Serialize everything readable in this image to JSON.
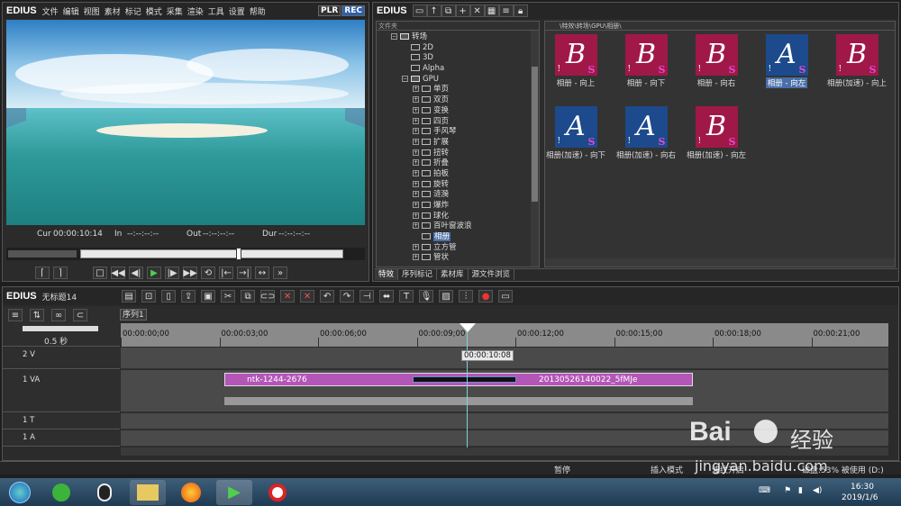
{
  "player": {
    "logo": "EDIUS",
    "menu": [
      "文件",
      "编辑",
      "视图",
      "素材",
      "标记",
      "模式",
      "采集",
      "渲染",
      "工具",
      "设置",
      "帮助"
    ],
    "plr": "PLR",
    "rec": "REC",
    "cur_label": "Cur",
    "cur_value": "00:00:10:14",
    "in_label": "In",
    "in_value": "--:--:--:--",
    "out_label": "Out",
    "out_value": "--:--:--:--",
    "dur_label": "Dur",
    "dur_value": "--:--:--:--"
  },
  "bin": {
    "logo": "EDIUS",
    "folder_header": "文件夹",
    "path": "\\特效\\转场\\GPU\\相册\\",
    "tree": [
      {
        "label": "转场",
        "indent": 1,
        "type": "folder",
        "exp": "−"
      },
      {
        "label": "2D",
        "indent": 2,
        "type": "fi"
      },
      {
        "label": "3D",
        "indent": 2,
        "type": "fi"
      },
      {
        "label": "Alpha",
        "indent": 2,
        "type": "fi"
      },
      {
        "label": "GPU",
        "indent": 2,
        "type": "folder",
        "exp": "−"
      },
      {
        "label": "单页",
        "indent": 3,
        "type": "fi",
        "exp": "+"
      },
      {
        "label": "双页",
        "indent": 3,
        "type": "fi",
        "exp": "+"
      },
      {
        "label": "变换",
        "indent": 3,
        "type": "fi",
        "exp": "+"
      },
      {
        "label": "四页",
        "indent": 3,
        "type": "fi",
        "exp": "+"
      },
      {
        "label": "手风琴",
        "indent": 3,
        "type": "fi",
        "exp": "+"
      },
      {
        "label": "扩展",
        "indent": 3,
        "type": "fi",
        "exp": "+"
      },
      {
        "label": "扭转",
        "indent": 3,
        "type": "fi",
        "exp": "+"
      },
      {
        "label": "折叠",
        "indent": 3,
        "type": "fi",
        "exp": "+"
      },
      {
        "label": "拍板",
        "indent": 3,
        "type": "fi",
        "exp": "+"
      },
      {
        "label": "旋转",
        "indent": 3,
        "type": "fi",
        "exp": "+"
      },
      {
        "label": "涟漪",
        "indent": 3,
        "type": "fi",
        "exp": "+"
      },
      {
        "label": "爆炸",
        "indent": 3,
        "type": "fi",
        "exp": "+"
      },
      {
        "label": "球化",
        "indent": 3,
        "type": "fi",
        "exp": "+"
      },
      {
        "label": "百叶窗波浪",
        "indent": 3,
        "type": "fi",
        "exp": "+"
      },
      {
        "label": "相册",
        "indent": 3,
        "type": "fi",
        "sel": true
      },
      {
        "label": "立方管",
        "indent": 3,
        "type": "fi",
        "exp": "+"
      },
      {
        "label": "管状",
        "indent": 3,
        "type": "fi",
        "exp": "+"
      }
    ],
    "tabs": [
      "特效",
      "序列标记",
      "素材库",
      "源文件浏览"
    ],
    "thumbs": [
      {
        "label": "相册 - 向上",
        "letter": "B",
        "color": "red"
      },
      {
        "label": "相册 - 向下",
        "letter": "B",
        "color": "red"
      },
      {
        "label": "相册 - 向右",
        "letter": "B",
        "color": "red"
      },
      {
        "label": "相册 - 向左",
        "letter": "A",
        "color": "blue",
        "hl": true
      },
      {
        "label": "相册(加速) - 向上",
        "letter": "B",
        "color": "red"
      },
      {
        "label": "相册(加速) - 向下",
        "letter": "A",
        "color": "blue"
      },
      {
        "label": "相册(加速) - 向右",
        "letter": "A",
        "color": "blue"
      },
      {
        "label": "相册(加速) - 向左",
        "letter": "B",
        "color": "red"
      }
    ]
  },
  "timeline": {
    "logo": "EDIUS",
    "project": "无标题14",
    "sequence_tab": "序列1",
    "zoom": "0.5 秒",
    "ruler": [
      "00:00:00;00",
      "00:00:03;00",
      "00:00:06;00",
      "00:00:09;00",
      "00:00:12;00",
      "00:00:15;00",
      "00:00:18;00",
      "00:00:21;00"
    ],
    "playhead_tc": "00:00:10:08",
    "tracks": {
      "v2": "2 V",
      "va1": "1 VA",
      "t1": "1 T",
      "a1": "1 A"
    },
    "clip1": "ntk-1244-2676",
    "clip2": "20130526140022_5fMJe"
  },
  "status": {
    "pause": "暂停",
    "insert": "插入模式",
    "ripple": "波纹开启",
    "disk": "磁盘:53% 被使用 (D:)"
  },
  "taskbar": {
    "time": "16:30",
    "date": "2019/1/6"
  },
  "watermark": {
    "site": "jingyan.baidu.com",
    "brand": "Bai",
    "brand2": "经验"
  }
}
